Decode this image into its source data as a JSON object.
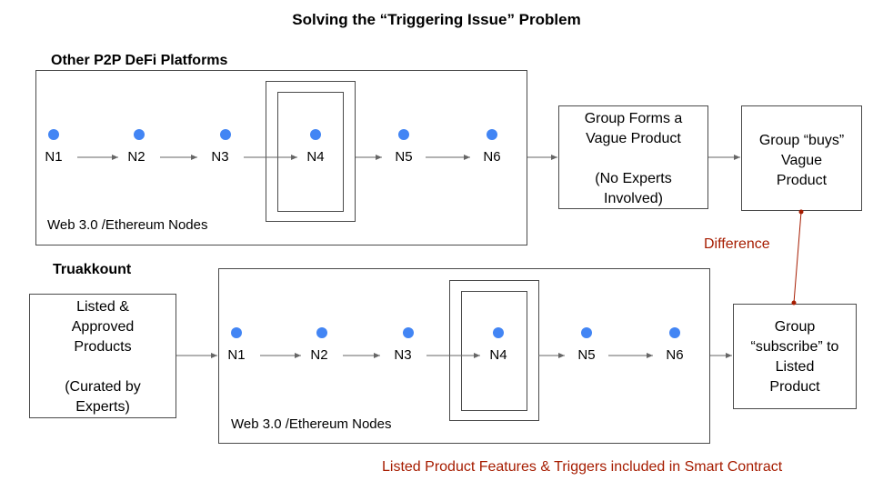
{
  "title": "Solving the “Triggering Issue” Problem",
  "top_section": {
    "label": "Other P2P DeFi Platforms",
    "footer": "Web 3.0 /Ethereum Nodes",
    "nodes": [
      "N1",
      "N2",
      "N3",
      "N4",
      "N5",
      "N6"
    ],
    "group_forms": "Group Forms a\nVague Product\n\n(No Experts\nInvolved)",
    "group_buys": "Group “buys”\nVague\nProduct"
  },
  "bottom_section": {
    "label": "Truakkount",
    "footer": "Web 3.0 /Ethereum Nodes",
    "nodes": [
      "N1",
      "N2",
      "N3",
      "N4",
      "N5",
      "N6"
    ],
    "listed_products": "Listed &\nApproved\nProducts\n\n(Curated by\nExperts)",
    "group_subscribe": "Group\n“subscribe” to\nListed\nProduct"
  },
  "difference_label": "Difference",
  "smart_contract_note": "Listed Product Features & Triggers included in Smart Contract",
  "colors": {
    "node": "#4285f4",
    "accent_red": "#a61c00",
    "arrow": "#666666",
    "border": "#4a4a4a"
  }
}
